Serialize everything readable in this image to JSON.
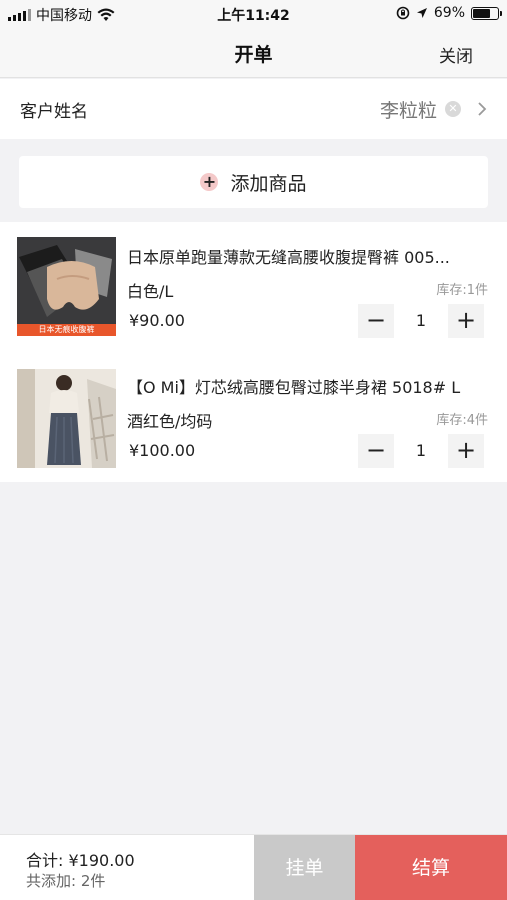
{
  "status_bar": {
    "carrier": "中国移动",
    "time": "上午11:42",
    "battery": "69%",
    "battery_level": 0.69,
    "icons": [
      "signal-icon",
      "wifi-icon",
      "rotation-lock-icon",
      "location-icon",
      "battery-icon"
    ]
  },
  "nav": {
    "title": "开单",
    "close_label": "关闭"
  },
  "customer": {
    "label": "客户姓名",
    "value": "李粒粒",
    "clear_glyph": "✕",
    "chevron_icon": "chevron-right-icon"
  },
  "add_product": {
    "icon_glyph": "+",
    "label": "添加商品"
  },
  "products": [
    {
      "title": "日本原单跑量薄款无缝高腰收腹提臀裤 005...",
      "spec": "白色/L",
      "stock": "库存:1件",
      "price": "¥90.00",
      "quantity": "1",
      "thumb_caption": "日本无痕收腹裤"
    },
    {
      "title": "【O Mi】灯芯绒高腰包臀过膝半身裙 5018# L",
      "spec": "酒红色/均码",
      "stock": "库存:4件",
      "price": "¥100.00",
      "quantity": "1"
    }
  ],
  "stepper": {
    "minus": "−",
    "plus": "+"
  },
  "footer": {
    "total": "合计:  ¥190.00",
    "count": "共添加:  2件",
    "hold_label": "挂单",
    "settle_label": "结算"
  },
  "colors": {
    "accent": "#e4605c",
    "hold_button": "#c9c9c9",
    "background": "#f2f2f4"
  }
}
